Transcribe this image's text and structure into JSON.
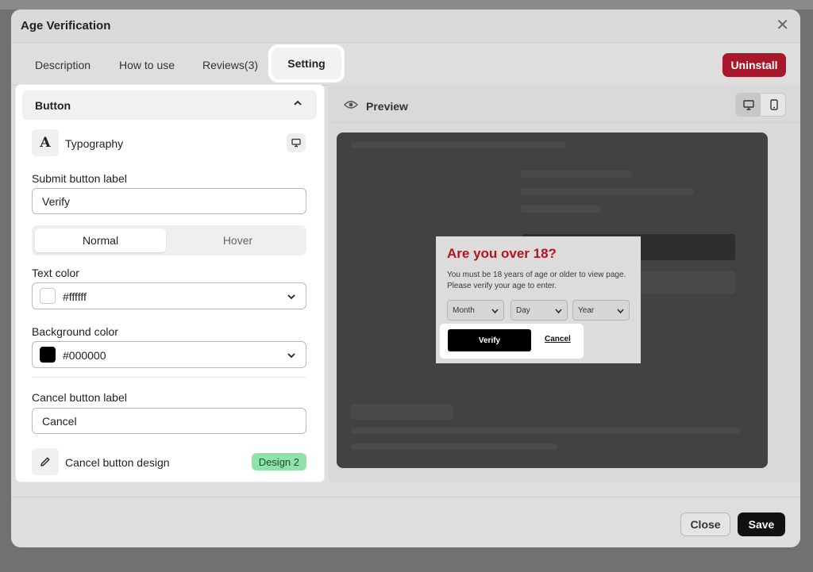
{
  "modal": {
    "title": "Age Verification",
    "close_icon": "close-icon"
  },
  "tabs": [
    {
      "label": "Description"
    },
    {
      "label": "How to use"
    },
    {
      "label": "Reviews(3)"
    },
    {
      "label": "Setting",
      "active": true
    }
  ],
  "uninstall_label": "Uninstall",
  "settings": {
    "section_title": "Button",
    "typography_label": "Typography",
    "submit_label_title": "Submit button label",
    "submit_label_value": "Verify",
    "state_options": [
      "Normal",
      "Hover"
    ],
    "selected_state": "Normal",
    "text_color_title": "Text color",
    "text_color_value": "#ffffff",
    "bg_color_title": "Background color",
    "bg_color_value": "#000000",
    "cancel_label_title": "Cancel button label",
    "cancel_label_value": "Cancel",
    "cancel_design_label": "Cancel button design",
    "cancel_design_value": "Design 2"
  },
  "preview": {
    "label": "Preview",
    "popup": {
      "title": "Are you over 18?",
      "text": "You must be 18 years of age or older to view page. Please verify your age to enter.",
      "selects": [
        "Month",
        "Day",
        "Year"
      ],
      "verify_label": "Verify",
      "cancel_label": "Cancel"
    }
  },
  "footer": {
    "close_label": "Close",
    "save_label": "Save"
  },
  "colors": {
    "accent_uninstall": "#a8172a",
    "popup_title": "#b3141e",
    "design_badge": "#8fe3a8"
  }
}
